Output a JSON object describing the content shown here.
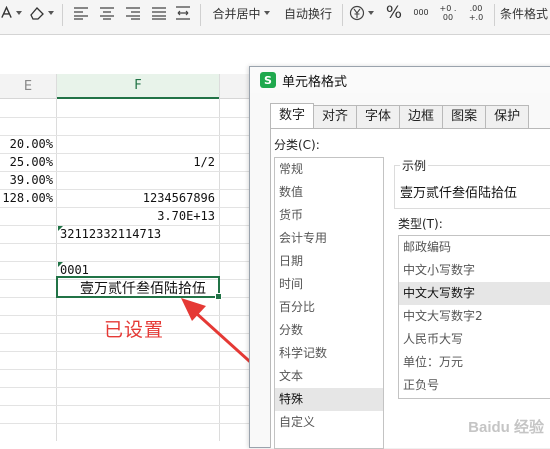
{
  "ribbon": {
    "merge_center": "合并居中",
    "auto_wrap": "自动换行",
    "cell_format": "条件格式",
    "percent": "%",
    "thousands": "000",
    "inc_decimal": "+0 .00",
    "dec_decimal": ".00 +.0"
  },
  "grid": {
    "col_e": "E",
    "col_f": "F",
    "col_e_values": [
      "20.00%",
      "25.00%",
      "39.00%",
      "128.00%"
    ],
    "col_f_values": [
      "1/2",
      "1234567896",
      "3.70E+13",
      "32112332114713",
      "0001",
      "壹万贰仟叁佰陆拾伍"
    ]
  },
  "annotation": "已设置",
  "dialog": {
    "title": "单元格格式",
    "tabs": [
      "数字",
      "对齐",
      "字体",
      "边框",
      "图案",
      "保护"
    ],
    "active_tab": "数字",
    "category_label": "分类(C):",
    "categories": [
      "常规",
      "数值",
      "货币",
      "会计专用",
      "日期",
      "时间",
      "百分比",
      "分数",
      "科学记数",
      "文本",
      "特殊",
      "自定义"
    ],
    "selected_category": "特殊",
    "sample_label": "示例",
    "sample_value": "壹万贰仟叁佰陆拾伍",
    "type_label": "类型(T):",
    "types": [
      "邮政编码",
      "中文小写数字",
      "中文大写数字",
      "中文大写数字2",
      "人民币大写",
      "单位：万元",
      "正负号"
    ],
    "selected_type": "中文大写数字"
  },
  "watermark": "Baidu 经验"
}
